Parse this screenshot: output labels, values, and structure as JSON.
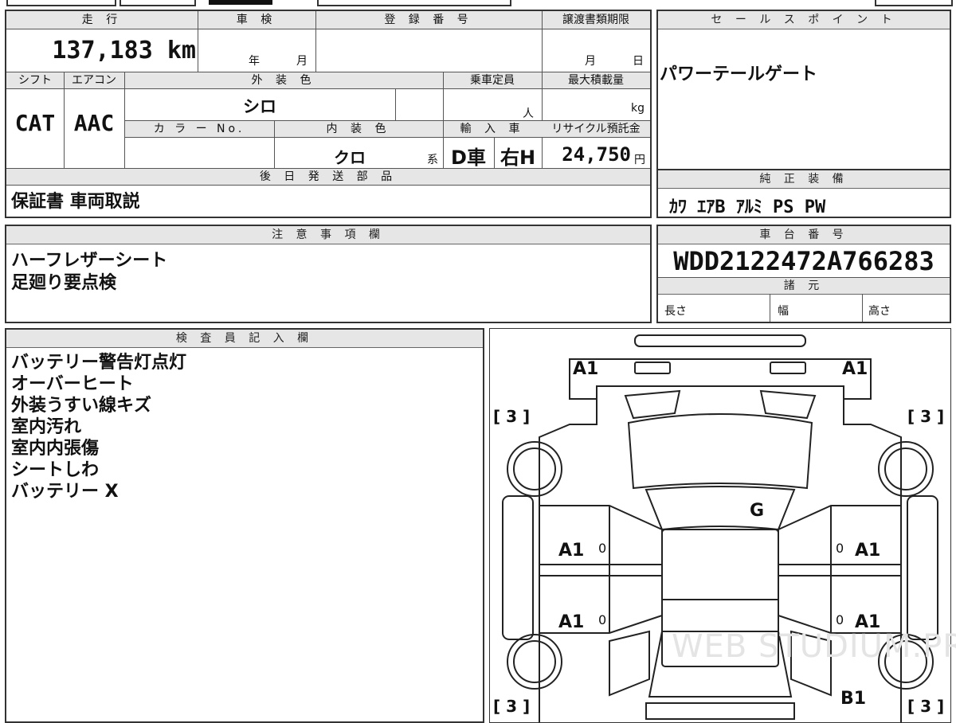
{
  "top_left": {
    "mileage_label": "走 行",
    "mileage_value": "137,183 km",
    "inspection_label": "車 検",
    "inspection_year": "年",
    "inspection_month": "月",
    "registration_label": "登 録 番 号",
    "transfer_label": "譲渡書類期限",
    "transfer_month": "月",
    "transfer_day": "日",
    "shift_label": "シフト",
    "aircon_label": "エアコン",
    "exterior_label": "外 装 色",
    "capacity_label": "乗車定員",
    "maxload_label": "最大積載量",
    "shift_value": "CAT",
    "aircon_value": "AAC",
    "exterior_value": "シロ",
    "capacity_unit": "人",
    "maxload_unit": "kg",
    "colorno_label": "カ ラ ー No.",
    "interior_label": "内 装 色",
    "import_label": "輸 入 車",
    "recycle_label": "リサイクル預託金",
    "interior_value": "クロ",
    "interior_suffix": "系",
    "import_dealer": "D車",
    "import_handle": "右H",
    "recycle_value": "24,750",
    "recycle_unit": "円",
    "later_parts_label": "後 日 発 送 部 品",
    "later_parts_value": "保証書 車両取説"
  },
  "sales_point": {
    "label": "セ ー ル ス ポ イ ン ト",
    "value": "パワーテールゲート"
  },
  "equipment": {
    "label": "純 正 装 備",
    "value": "ｶﾜ ｴｱB ｱﾙﾐ PS PW"
  },
  "notes": {
    "label": "注 意 事 項 欄",
    "lines": [
      "ハーフレザーシート",
      "足廻り要点検"
    ]
  },
  "chassis": {
    "label": "車 台 番 号",
    "value": "WDD2122472A766283",
    "spec_label": "諸 元",
    "length_label": "長さ",
    "width_label": "幅",
    "height_label": "高さ"
  },
  "inspector": {
    "label": "検 査 員 記 入 欄",
    "lines": [
      "バッテリー警告灯点灯",
      "オーバーヒート",
      "外装うすい線キズ",
      "室内汚れ",
      "室内内張傷",
      "シートしわ",
      "バッテリー X"
    ]
  },
  "diagram": {
    "front_left": "A1",
    "front_right": "A1",
    "tire_fl": "[ 3 ]",
    "tire_fr": "[ 3 ]",
    "tire_rl": "[ 3 ]",
    "tire_rr": "[ 3 ]",
    "roof": "G",
    "door_fl": "A1",
    "door_fr": "A1",
    "door_rl": "A1",
    "door_rr": "A1",
    "zero_fl": "0",
    "zero_fr": "0",
    "zero_rl": "0",
    "zero_rr": "0",
    "rear_right": "B1",
    "watermark": "WEB STUDIUM.PRO"
  }
}
